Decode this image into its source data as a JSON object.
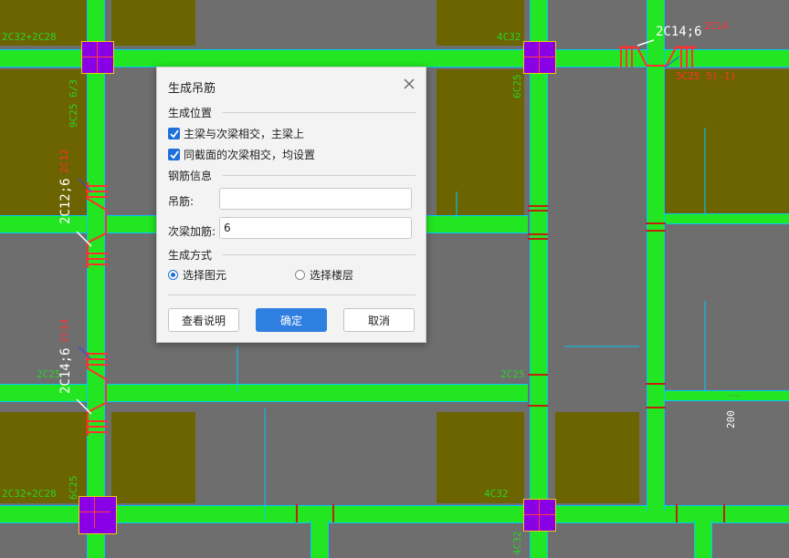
{
  "dialog": {
    "title": "生成吊筋",
    "section_position": "生成位置",
    "opt_main_secondary": "主梁与次梁相交，主梁上",
    "opt_same_section": "同截面的次梁相交，均设置",
    "section_rebar": "钢筋信息",
    "label_hanger": "吊筋:",
    "hanger_value": "",
    "label_secondary_add": "次梁加筋:",
    "secondary_add_value": "6",
    "section_method": "生成方式",
    "radio_select_element": "选择图元",
    "radio_select_floor": "选择楼层",
    "btn_help": "查看说明",
    "btn_ok": "确定",
    "btn_cancel": "取消"
  },
  "cad": {
    "t1": "2C32+2C28",
    "t2": "4C32",
    "t3": "2C14;6",
    "t4": "2C14",
    "t5": "5C25 5(-1)",
    "t6": "2C12;6",
    "t7": "2C12",
    "t8": "2C14;6",
    "t9": "2C14",
    "t10": "2C32+2C28",
    "t11": "4C32",
    "t12": "2C25",
    "t13": "2C25",
    "t14": "200",
    "t15": "9C25 6/3",
    "t16": "6C25",
    "t17": "6C25",
    "t18": "4C32"
  },
  "colors": {
    "beam": "#22e622",
    "column": "#8a00e6",
    "slab": "#6b6400",
    "background": "#6e6e6e",
    "primary_button": "#2f7fe0"
  }
}
